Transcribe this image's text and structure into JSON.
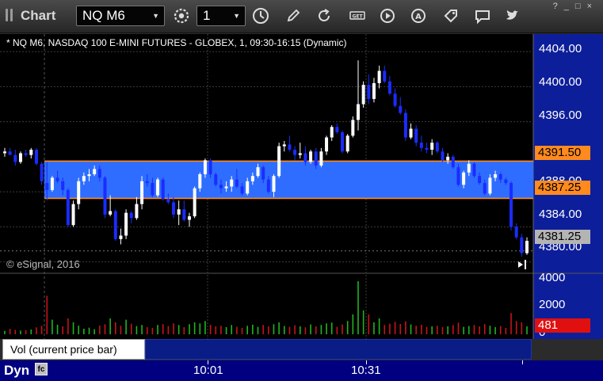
{
  "toolbar": {
    "title": "Chart",
    "symbol": "NQ M6",
    "interval": "1",
    "icons": [
      "settings-icon",
      "clock-icon",
      "pencil-icon",
      "refresh-icon",
      "get-icon",
      "play-icon",
      "alert-icon",
      "tag-icon",
      "comment-icon",
      "twitter-icon"
    ],
    "window_controls": [
      "?",
      "_",
      "□",
      "×"
    ]
  },
  "chart": {
    "header": "* NQ M6, NASDAQ 100 E-MINI FUTURES - GLOBEX, 1, 09:30-16:15 (Dynamic)",
    "copyright": "© eSignal, 2016",
    "price_axis": [
      "4404.00",
      "4400.00",
      "4396.00",
      "4388.00",
      "4384.00",
      "4380.00"
    ],
    "zone_upper_tag": "4391.50",
    "zone_lower_tag": "4387.25",
    "last_price_tag": "4381.25",
    "volume_axis": [
      "4000",
      "2000",
      "0"
    ],
    "volume_tag": "481",
    "time_labels": [
      "10:01",
      "10:31"
    ],
    "colors": {
      "background": "#000000",
      "grid": "#3c3c3c",
      "zone_fill": "#2e6dff",
      "zone_border": "#ff8a1e",
      "candle_up": "#ffffff",
      "candle_down": "#1a2cff",
      "vol_up": "#1fb51f",
      "vol_down": "#c4141b",
      "last_tag": "#b4b4b4",
      "volume_tag": "#e01010",
      "panel_bar": "#0a1c86",
      "footer": "#000080"
    }
  },
  "study": {
    "label": "Vol (current price bar)",
    "close": "×"
  },
  "footer": {
    "label": "Dyn",
    "icon": "fc"
  },
  "chart_data": {
    "type": "candlestick",
    "symbol": "NQ M6",
    "description": "NASDAQ 100 E-MINI FUTURES - GLOBEX, 1-minute",
    "yticks": [
      4404.0,
      4400.0,
      4396.0,
      4388.0,
      4384.0,
      4380.0
    ],
    "ylim": [
      4378.7,
      4406.0
    ],
    "xticks": [
      "10:01",
      "10:31"
    ],
    "zone": [
      4387.25,
      4391.5
    ],
    "last_price": 4381.25,
    "candles": [
      [
        4392.4,
        4393.0,
        4392.0,
        4392.6
      ],
      [
        4392.6,
        4393.0,
        4392.2,
        4392.2
      ],
      [
        4392.2,
        4392.8,
        4391.0,
        4391.4
      ],
      [
        4391.4,
        4392.6,
        4391.2,
        4392.4
      ],
      [
        4392.4,
        4392.8,
        4392.0,
        4392.2
      ],
      [
        4392.2,
        4393.0,
        4391.8,
        4392.8
      ],
      [
        4392.8,
        4393.0,
        4391.0,
        4391.2
      ],
      [
        4391.2,
        4391.4,
        4388.8,
        4389.2
      ],
      [
        4389.0,
        4391.4,
        4387.0,
        4388.2
      ],
      [
        4388.2,
        4389.8,
        4388.0,
        4389.6
      ],
      [
        4389.6,
        4390.4,
        4389.0,
        4389.2
      ],
      [
        4389.2,
        4389.6,
        4387.6,
        4388.2
      ],
      [
        4388.2,
        4388.4,
        4384.0,
        4384.2
      ],
      [
        4384.2,
        4387.0,
        4384.0,
        4386.6
      ],
      [
        4386.6,
        4389.6,
        4386.0,
        4389.2
      ],
      [
        4389.2,
        4390.2,
        4388.8,
        4389.8
      ],
      [
        4389.8,
        4390.6,
        4389.2,
        4390.0
      ],
      [
        4390.0,
        4391.0,
        4389.8,
        4390.6
      ],
      [
        4390.6,
        4391.0,
        4389.2,
        4389.6
      ],
      [
        4389.6,
        4389.8,
        4385.0,
        4385.4
      ],
      [
        4385.4,
        4387.6,
        4385.2,
        4385.8
      ],
      [
        4385.8,
        4386.0,
        4382.4,
        4382.6
      ],
      [
        4382.6,
        4383.8,
        4382.0,
        4383.0
      ],
      [
        4383.0,
        4386.0,
        4382.6,
        4385.6
      ],
      [
        4385.6,
        4385.8,
        4384.4,
        4385.0
      ],
      [
        4385.0,
        4387.4,
        4384.8,
        4386.6
      ],
      [
        4386.6,
        4389.8,
        4386.0,
        4389.2
      ],
      [
        4389.2,
        4390.0,
        4388.6,
        4389.0
      ],
      [
        4389.0,
        4389.6,
        4387.4,
        4387.6
      ],
      [
        4387.6,
        4389.6,
        4387.4,
        4389.4
      ],
      [
        4389.4,
        4389.6,
        4387.0,
        4387.2
      ],
      [
        4387.2,
        4387.8,
        4386.6,
        4386.8
      ],
      [
        4386.8,
        4387.4,
        4385.0,
        4385.4
      ],
      [
        4385.4,
        4387.0,
        4384.2,
        4386.0
      ],
      [
        4386.0,
        4387.0,
        4384.6,
        4384.8
      ],
      [
        4384.8,
        4385.6,
        4384.0,
        4385.2
      ],
      [
        4385.2,
        4388.6,
        4385.0,
        4388.4
      ],
      [
        4388.4,
        4390.2,
        4388.0,
        4390.0
      ],
      [
        4390.0,
        4391.8,
        4389.6,
        4391.6
      ],
      [
        4391.6,
        4391.8,
        4389.6,
        4390.0
      ],
      [
        4390.0,
        4390.2,
        4388.6,
        4388.8
      ],
      [
        4388.8,
        4389.4,
        4387.8,
        4388.4
      ],
      [
        4388.4,
        4389.2,
        4388.0,
        4388.6
      ],
      [
        4388.6,
        4389.8,
        4388.0,
        4389.4
      ],
      [
        4389.4,
        4390.6,
        4388.4,
        4388.6
      ],
      [
        4388.6,
        4389.0,
        4387.6,
        4387.8
      ],
      [
        4387.8,
        4389.6,
        4387.6,
        4389.2
      ],
      [
        4389.2,
        4390.2,
        4388.8,
        4389.8
      ],
      [
        4389.8,
        4391.2,
        4389.6,
        4390.8
      ],
      [
        4390.8,
        4391.0,
        4389.0,
        4389.4
      ],
      [
        4389.4,
        4389.8,
        4387.8,
        4388.0
      ],
      [
        4388.0,
        4390.0,
        4387.4,
        4389.8
      ],
      [
        4389.8,
        4393.6,
        4389.6,
        4393.2
      ],
      [
        4393.2,
        4393.8,
        4392.6,
        4393.4
      ],
      [
        4393.4,
        4394.4,
        4392.6,
        4392.8
      ],
      [
        4392.8,
        4393.2,
        4391.6,
        4392.2
      ],
      [
        4392.2,
        4393.6,
        4391.8,
        4392.4
      ],
      [
        4392.4,
        4393.2,
        4391.0,
        4391.4
      ],
      [
        4391.4,
        4392.8,
        4391.2,
        4392.6
      ],
      [
        4392.6,
        4393.0,
        4390.6,
        4391.0
      ],
      [
        4391.0,
        4393.0,
        4390.8,
        4392.6
      ],
      [
        4392.6,
        4394.4,
        4392.2,
        4394.2
      ],
      [
        4394.2,
        4395.6,
        4393.8,
        4395.4
      ],
      [
        4395.4,
        4395.8,
        4394.6,
        4394.8
      ],
      [
        4394.8,
        4395.0,
        4392.4,
        4392.6
      ],
      [
        4392.6,
        4394.6,
        4392.4,
        4394.4
      ],
      [
        4394.4,
        4396.6,
        4394.2,
        4396.2
      ],
      [
        4396.2,
        4403.0,
        4395.0,
        4398.0
      ],
      [
        4398.0,
        4400.6,
        4397.6,
        4400.2
      ],
      [
        4400.2,
        4401.4,
        4398.0,
        4398.6
      ],
      [
        4398.6,
        4401.0,
        4398.2,
        4400.4
      ],
      [
        4400.4,
        4402.4,
        4399.8,
        4401.8
      ],
      [
        4401.8,
        4402.4,
        4400.4,
        4400.6
      ],
      [
        4400.6,
        4401.2,
        4399.0,
        4399.2
      ],
      [
        4399.2,
        4399.8,
        4397.6,
        4397.8
      ],
      [
        4397.8,
        4398.8,
        4396.8,
        4397.0
      ],
      [
        4397.0,
        4397.4,
        4393.8,
        4394.2
      ],
      [
        4394.2,
        4395.8,
        4394.0,
        4395.2
      ],
      [
        4395.2,
        4395.6,
        4393.2,
        4393.6
      ],
      [
        4393.6,
        4394.4,
        4392.6,
        4393.0
      ],
      [
        4393.0,
        4393.6,
        4392.4,
        4392.8
      ],
      [
        4392.8,
        4394.0,
        4392.2,
        4393.6
      ],
      [
        4393.6,
        4393.8,
        4392.4,
        4392.6
      ],
      [
        4392.6,
        4393.0,
        4391.4,
        4391.6
      ],
      [
        4391.6,
        4392.4,
        4391.2,
        4392.0
      ],
      [
        4392.0,
        4392.2,
        4390.6,
        4390.8
      ],
      [
        4390.8,
        4391.2,
        4388.6,
        4388.8
      ],
      [
        4388.8,
        4390.4,
        4388.4,
        4390.2
      ],
      [
        4390.2,
        4391.6,
        4389.8,
        4391.2
      ],
      [
        4391.2,
        4391.4,
        4389.6,
        4389.8
      ],
      [
        4389.8,
        4390.2,
        4388.8,
        4389.0
      ],
      [
        4389.0,
        4389.4,
        4387.6,
        4387.8
      ],
      [
        4387.8,
        4390.0,
        4387.6,
        4389.6
      ],
      [
        4389.6,
        4390.4,
        4389.2,
        4390.0
      ],
      [
        4390.0,
        4390.2,
        4389.0,
        4389.4
      ],
      [
        4389.4,
        4389.6,
        4388.8,
        4389.0
      ],
      [
        4389.0,
        4389.2,
        4383.6,
        4384.0
      ],
      [
        4384.0,
        4384.4,
        4382.6,
        4382.8
      ],
      [
        4382.8,
        4383.2,
        4380.6,
        4381.0
      ],
      [
        4381.0,
        4382.8,
        4380.8,
        4382.4
      ]
    ],
    "volume_ylim": [
      0,
      4600
    ],
    "volume": [
      [
        260,
        1
      ],
      [
        420,
        0
      ],
      [
        330,
        0
      ],
      [
        280,
        1
      ],
      [
        300,
        0
      ],
      [
        360,
        1
      ],
      [
        520,
        0
      ],
      [
        640,
        0
      ],
      [
        2900,
        0
      ],
      [
        1100,
        1
      ],
      [
        720,
        1
      ],
      [
        600,
        0
      ],
      [
        1200,
        0
      ],
      [
        900,
        1
      ],
      [
        650,
        1
      ],
      [
        420,
        1
      ],
      [
        500,
        1
      ],
      [
        380,
        1
      ],
      [
        650,
        0
      ],
      [
        760,
        0
      ],
      [
        1200,
        1
      ],
      [
        900,
        0
      ],
      [
        640,
        0
      ],
      [
        1100,
        1
      ],
      [
        800,
        0
      ],
      [
        620,
        1
      ],
      [
        700,
        1
      ],
      [
        540,
        0
      ],
      [
        480,
        0
      ],
      [
        700,
        1
      ],
      [
        760,
        0
      ],
      [
        620,
        0
      ],
      [
        820,
        0
      ],
      [
        700,
        1
      ],
      [
        540,
        0
      ],
      [
        760,
        1
      ],
      [
        900,
        1
      ],
      [
        820,
        1
      ],
      [
        1000,
        1
      ],
      [
        720,
        0
      ],
      [
        600,
        0
      ],
      [
        640,
        0
      ],
      [
        540,
        1
      ],
      [
        700,
        1
      ],
      [
        560,
        0
      ],
      [
        480,
        0
      ],
      [
        640,
        1
      ],
      [
        720,
        1
      ],
      [
        560,
        1
      ],
      [
        700,
        0
      ],
      [
        600,
        0
      ],
      [
        760,
        1
      ],
      [
        900,
        1
      ],
      [
        620,
        1
      ],
      [
        560,
        0
      ],
      [
        680,
        0
      ],
      [
        600,
        1
      ],
      [
        520,
        0
      ],
      [
        740,
        1
      ],
      [
        600,
        0
      ],
      [
        700,
        1
      ],
      [
        820,
        1
      ],
      [
        880,
        1
      ],
      [
        560,
        0
      ],
      [
        740,
        0
      ],
      [
        1000,
        1
      ],
      [
        1500,
        1
      ],
      [
        4000,
        1
      ],
      [
        1800,
        1
      ],
      [
        1500,
        0
      ],
      [
        900,
        1
      ],
      [
        1200,
        1
      ],
      [
        700,
        0
      ],
      [
        800,
        0
      ],
      [
        940,
        0
      ],
      [
        780,
        0
      ],
      [
        980,
        0
      ],
      [
        740,
        1
      ],
      [
        640,
        0
      ],
      [
        720,
        0
      ],
      [
        560,
        0
      ],
      [
        600,
        1
      ],
      [
        640,
        0
      ],
      [
        540,
        0
      ],
      [
        600,
        1
      ],
      [
        700,
        0
      ],
      [
        880,
        0
      ],
      [
        560,
        1
      ],
      [
        620,
        1
      ],
      [
        700,
        0
      ],
      [
        600,
        0
      ],
      [
        760,
        0
      ],
      [
        640,
        1
      ],
      [
        540,
        1
      ],
      [
        620,
        0
      ],
      [
        480,
        0
      ],
      [
        1600,
        0
      ],
      [
        1000,
        0
      ],
      [
        900,
        0
      ],
      [
        600,
        1
      ]
    ]
  }
}
